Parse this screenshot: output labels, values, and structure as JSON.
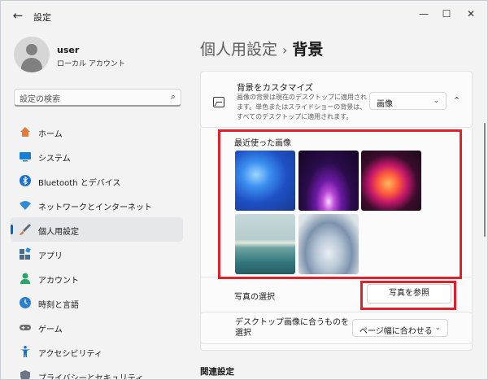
{
  "window": {
    "title": "設定",
    "minimize": "—",
    "maximize": "☐",
    "close": "✕",
    "back": "←"
  },
  "profile": {
    "name": "user",
    "subtitle": "ローカル アカウント"
  },
  "search": {
    "placeholder": "設定の検索",
    "icon": "search-icon"
  },
  "nav": {
    "items": [
      {
        "label": "ホーム",
        "icon": "home-icon",
        "color": "#e07b3c"
      },
      {
        "label": "システム",
        "icon": "system-icon",
        "color": "#1a7fd4"
      },
      {
        "label": "Bluetooth とデバイス",
        "icon": "bluetooth-icon",
        "color": "#1a6fd0"
      },
      {
        "label": "ネットワークとインターネット",
        "icon": "wifi-icon",
        "color": "#2f8dd8"
      },
      {
        "label": "個人用設定",
        "icon": "brush-icon",
        "color": "#d07a3a"
      },
      {
        "label": "アプリ",
        "icon": "apps-icon",
        "color": "#4a6b8a"
      },
      {
        "label": "アカウント",
        "icon": "account-icon",
        "color": "#29a56c"
      },
      {
        "label": "時刻と言語",
        "icon": "clock-globe-icon",
        "color": "#2a7fd0"
      },
      {
        "label": "ゲーム",
        "icon": "gamepad-icon",
        "color": "#6b6b6b"
      },
      {
        "label": "アクセシビリティ",
        "icon": "accessibility-icon",
        "color": "#1a6fd0"
      },
      {
        "label": "プライバシーとセキュリティ",
        "icon": "shield-icon",
        "color": "#6b7785"
      }
    ],
    "active_index": 4
  },
  "breadcrumb": {
    "parent": "個人用設定",
    "separator": "›",
    "current": "背景"
  },
  "background": {
    "title": "背景をカスタマイズ",
    "description": "画像の背景は現在のデスクトップに適用されます。単色またはスライドショーの背景は、すべてのデスクトップに適用されます。",
    "type_value": "画像",
    "recent_label": "最近使った画像",
    "choose_label": "写真の選択",
    "browse_button": "写真を参照",
    "fit_label": "デスクトップ画像に合うものを選択",
    "fit_value": "ページ幅に合わせる",
    "thumbnails": [
      "bloom-blue",
      "glow-purple",
      "flow-orange",
      "lake-sunrise",
      "bloom-white"
    ]
  },
  "related": {
    "title": "関連設定"
  },
  "colors": {
    "accent": "#0067c0",
    "highlight": "#e0202a"
  }
}
